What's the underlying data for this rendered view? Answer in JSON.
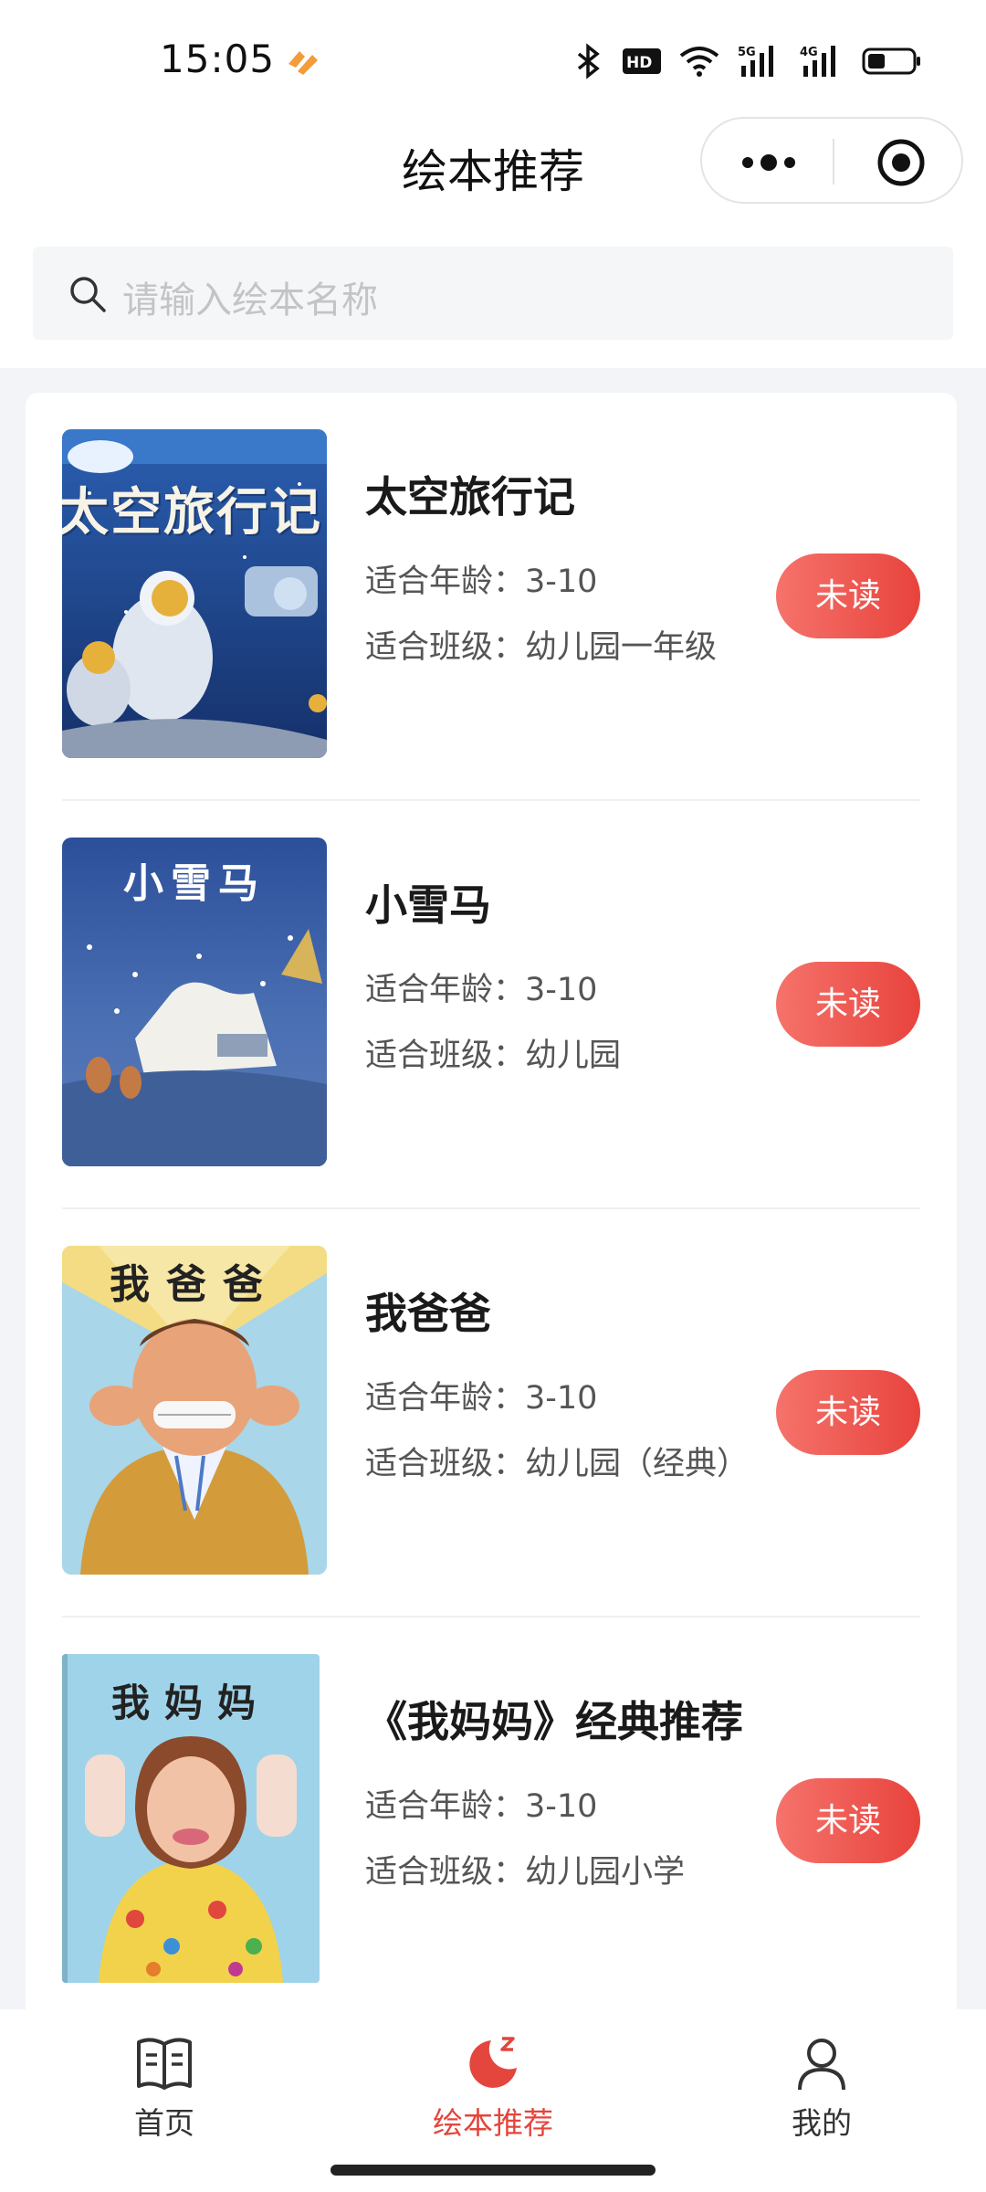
{
  "status": {
    "time": "15:05",
    "icons": [
      "bluetooth-icon",
      "hd-icon",
      "wifi-icon",
      "5g-signal-icon",
      "4g-signal-icon",
      "battery-icon"
    ]
  },
  "header": {
    "title": "绘本推荐"
  },
  "search": {
    "placeholder": "请输入绘本名称"
  },
  "books": [
    {
      "title": "太空旅行记",
      "age": "适合年龄：3-10",
      "class": "适合班级：幼儿园一年级",
      "button": "未读",
      "cover_text": "太空旅行记"
    },
    {
      "title": "小雪马",
      "age": "适合年龄：3-10",
      "class": "适合班级：幼儿园",
      "button": "未读",
      "cover_text": "小雪马"
    },
    {
      "title": "我爸爸",
      "age": "适合年龄：3-10",
      "class": "适合班级：幼儿园（经典）",
      "button": "未读",
      "cover_text": "我爸爸"
    },
    {
      "title": "《我妈妈》经典推荐",
      "age": "适合年龄：3-10",
      "class": "适合班级：幼儿园小学",
      "button": "未读",
      "cover_text": "我妈妈"
    }
  ],
  "tabs": [
    {
      "label": "首页",
      "icon": "book-icon",
      "active": false
    },
    {
      "label": "绘本推荐",
      "icon": "moon-icon",
      "active": true
    },
    {
      "label": "我的",
      "icon": "user-icon",
      "active": false
    }
  ],
  "colors": {
    "accent": "#e4453c",
    "button_gradient_start": "#f5736b",
    "button_gradient_end": "#e8433d",
    "page_background": "#f3f4f8"
  }
}
